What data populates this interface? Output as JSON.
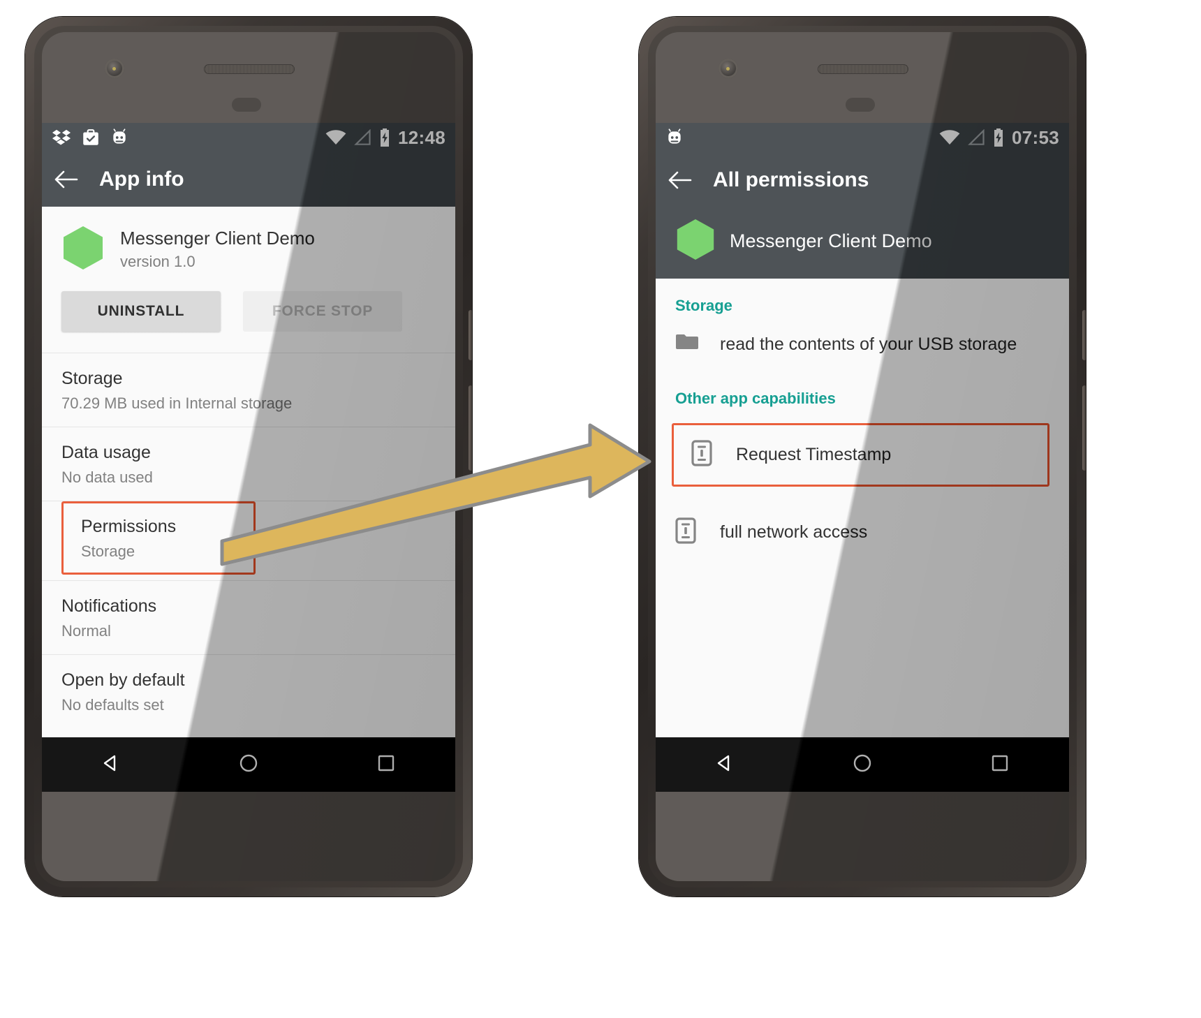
{
  "left_phone": {
    "status_bar": {
      "time": "12:48",
      "left_icons": [
        "dropbox-icon",
        "work-badge-icon",
        "android-head-icon"
      ],
      "right_icons": [
        "wifi-icon",
        "signal-icon",
        "battery-charging-icon"
      ]
    },
    "toolbar": {
      "back_label": "back-arrow-icon",
      "title": "App info"
    },
    "app": {
      "icon": "hexagon-app-icon",
      "name": "Messenger Client Demo",
      "version": "version 1.0"
    },
    "buttons": {
      "uninstall": "UNINSTALL",
      "force_stop": "FORCE STOP"
    },
    "rows": [
      {
        "title": "Storage",
        "subtitle": "70.29 MB used in Internal storage",
        "highlighted": false
      },
      {
        "title": "Data usage",
        "subtitle": "No data used",
        "highlighted": false
      },
      {
        "title": "Permissions",
        "subtitle": "Storage",
        "highlighted": true
      },
      {
        "title": "Notifications",
        "subtitle": "Normal",
        "highlighted": false
      },
      {
        "title": "Open by default",
        "subtitle": "No defaults set",
        "highlighted": false
      }
    ],
    "nav": [
      "back-nav-icon",
      "home-nav-icon",
      "recents-nav-icon"
    ]
  },
  "right_phone": {
    "status_bar": {
      "time": "07:53",
      "left_icons": [
        "android-head-icon"
      ],
      "right_icons": [
        "wifi-icon",
        "signal-icon",
        "battery-charging-icon"
      ]
    },
    "toolbar": {
      "back_label": "back-arrow-icon",
      "title": "All permissions"
    },
    "app": {
      "icon": "hexagon-app-icon",
      "name": "Messenger Client Demo"
    },
    "sections": [
      {
        "header": "Storage",
        "items": [
          {
            "icon": "folder-icon",
            "label": "read the contents of your USB storage",
            "highlighted": false
          }
        ]
      },
      {
        "header": "Other app capabilities",
        "items": [
          {
            "icon": "info-device-icon",
            "label": "Request Timestamp",
            "highlighted": true
          },
          {
            "icon": "info-device-icon",
            "label": "full network access",
            "highlighted": false
          }
        ]
      }
    ],
    "nav": [
      "back-nav-icon",
      "home-nav-icon",
      "recents-nav-icon"
    ]
  },
  "annotation": {
    "arrow": "pointer-arrow",
    "arrow_fill": "#ddb65c",
    "arrow_stroke": "#8c8c8c",
    "highlight_color": "#e8502a",
    "accent_teal": "#009688",
    "app_icon_green": "#6fcf63",
    "toolbar_color": "#3d4347"
  }
}
